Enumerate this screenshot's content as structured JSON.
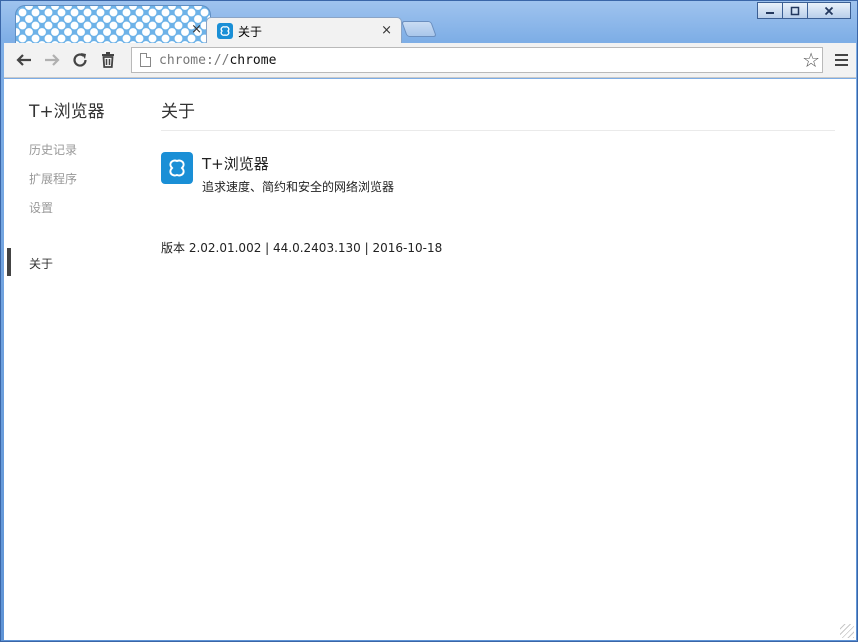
{
  "window": {
    "caption_minimize": "▁",
    "caption_maximize": "▢",
    "caption_close": "✕"
  },
  "tabs": [
    {
      "label": "",
      "close": "×",
      "active": false
    },
    {
      "label": "关于",
      "close": "×",
      "active": true
    }
  ],
  "toolbar": {
    "back_icon": "←",
    "forward_icon": "→",
    "reload_icon": "⟳",
    "trash_icon": "🗑",
    "url_scheme": "chrome://",
    "url_host": "chrome",
    "star_icon": "☆"
  },
  "sidebar": {
    "brand": "T+浏览器",
    "items": [
      {
        "label": "历史记录",
        "selected": false
      },
      {
        "label": "扩展程序",
        "selected": false
      },
      {
        "label": "设置",
        "selected": false
      },
      {
        "label": "关于",
        "selected": true
      }
    ]
  },
  "main": {
    "title": "关于",
    "app_name": "T+浏览器",
    "app_description": "追求速度、简约和安全的网络浏览器",
    "version": "版本 2.02.01.002 | 44.0.2403.130 | 2016-10-18"
  },
  "colors": {
    "brand_blue": "#1a8fd6",
    "frame_blue": "#6e9fd8"
  }
}
